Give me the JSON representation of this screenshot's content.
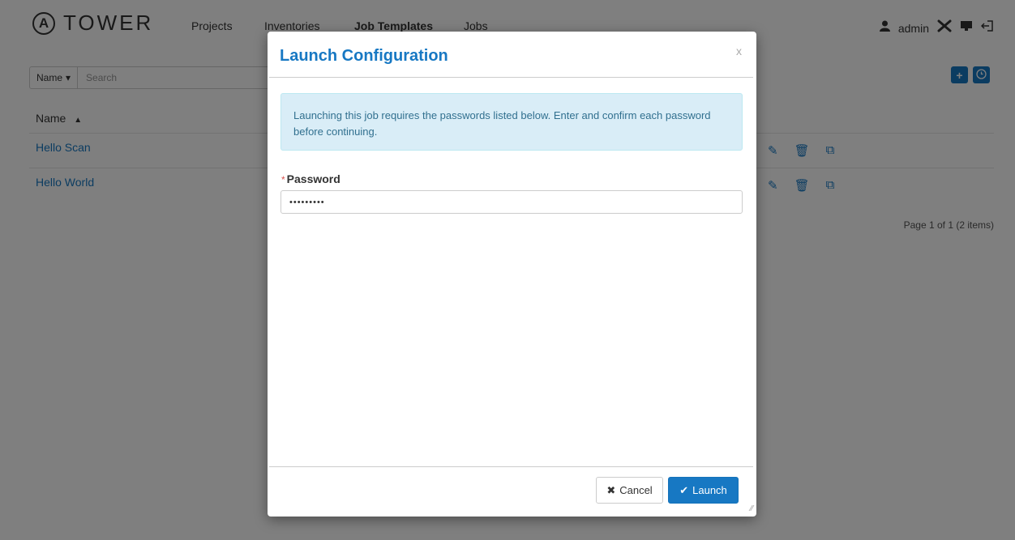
{
  "nav": {
    "logo_glyph": "A",
    "logo_text": "TOWER",
    "links": [
      "Projects",
      "Inventories",
      "Job Templates",
      "Jobs"
    ],
    "user": "admin"
  },
  "search": {
    "filter_label": "Name",
    "placeholder": "Search"
  },
  "list": {
    "column_name": "Name",
    "rows": [
      {
        "name": "Hello Scan"
      },
      {
        "name": "Hello World"
      }
    ],
    "pagination": "Page 1 of 1 (2 items)"
  },
  "modal": {
    "title": "Launch Configuration",
    "close": "x",
    "alert": "Launching this job requires the passwords listed below. Enter and confirm each password before continuing.",
    "password_label": "Password",
    "required_mark": "*",
    "password_value": "•••••••••",
    "cancel_label": "Cancel",
    "launch_label": "Launch"
  },
  "icons": {
    "add": "add-icon",
    "schedule": "clock-icon",
    "edit": "pencil-icon",
    "delete": "trash-icon",
    "copy": "copy-icon"
  },
  "colors": {
    "accent": "#1778c3",
    "alert_bg": "#d9edf7",
    "alert_text": "#31708f",
    "required": "#d9534f"
  }
}
